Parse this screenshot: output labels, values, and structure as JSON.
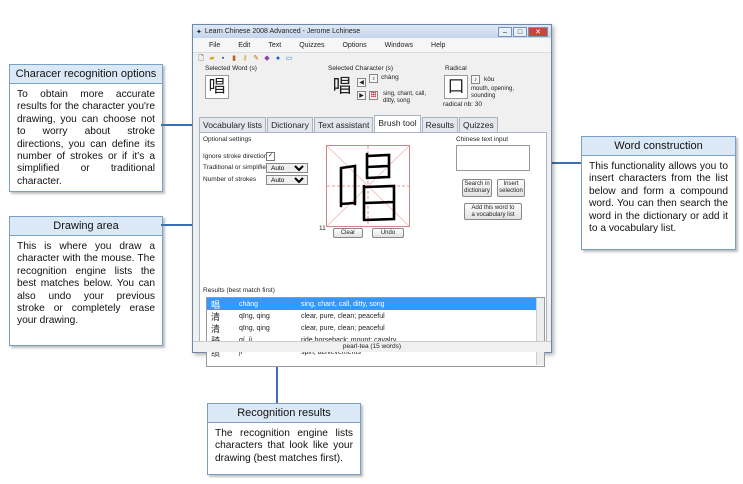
{
  "window": {
    "title": "Learn Chinese 2008 Advanced - Jerome Lchinese",
    "menu": [
      "File",
      "Edit",
      "Text",
      "Quizzes",
      "Options",
      "Windows",
      "Help"
    ],
    "selected_word_label": "Selected Word (s)",
    "selected_word": "唱",
    "selected_char_label": "Selected Character (s)",
    "selected_char": "唱",
    "selected_char_pinyin": "chàng",
    "selected_char_meaning": "sing, chant, call, ditty, song",
    "radical_label": "Radical",
    "radical_char": "口",
    "radical_pinyin": "kǒu",
    "radical_meaning": "mouth, opening, sounding",
    "radical_nb": "radical nb: 30",
    "tabs": [
      "Vocabulary lists",
      "Dictionary",
      "Text assistant",
      "Brush tool",
      "Results",
      "Quizzes"
    ],
    "active_tab": "Brush tool",
    "optional_settings_label": "Optional settings",
    "ignore_stroke_label": "Ignore stroke direction",
    "trad_simpl_label": "Traditional or simplified",
    "trad_simpl_value": "Auto",
    "num_strokes_label": "Number of strokes",
    "num_strokes_value": "Auto",
    "stroke_count": "11",
    "clear_label": "Clear",
    "undo_label": "Undo",
    "chinese_text_input_label": "Chinese text input",
    "search_dict_label": "Search in dictionary",
    "insert_selection_label": "Insert selection",
    "add_vocab_label": "Add this word to a vocabulary list",
    "results_label": "Results (best match first)",
    "results": [
      {
        "char": "唱",
        "pinyin": "chàng",
        "meaning": "sing, chant, call, ditty, song"
      },
      {
        "char": "清",
        "pinyin": "qīng, qing",
        "meaning": "clear, pure, clean; peaceful"
      },
      {
        "char": "清",
        "pinyin": "qīng, qing",
        "meaning": "clear, pure, clean; peaceful"
      },
      {
        "char": "骑",
        "pinyin": "qí, jì",
        "meaning": "ride horseback; mount; cavalry"
      },
      {
        "char": "绩",
        "pinyin": "jì",
        "meaning": "spin; achievements"
      }
    ],
    "status": "pearl-tea (15 words)"
  },
  "callouts": {
    "recognition_options": {
      "title": "Characer recognition options",
      "body": "To obtain more accurate results for the character you're drawing, you can choose not to worry about stroke directions, you can define its number of strokes or if it's a simplified or traditional character."
    },
    "drawing_area": {
      "title": "Drawing area",
      "body": "This is where you draw a character with the mouse. The recognition engine lists the best matches below. You can also undo your previous stroke or completely erase your drawing."
    },
    "word_construction": {
      "title": "Word construction",
      "body": "This functionality allows you to insert characters from the list below and form a compound word. You can then search the word in the dictionary or add it to a vocabulary list."
    },
    "recognition_results": {
      "title": "Recognition results",
      "body": "The recognition engine lists characters that look like your drawing (best matches first)."
    }
  },
  "colors": {
    "accent": "#3d6fb5",
    "selection": "#3399ff",
    "callout_header": "#dbe8f6"
  }
}
